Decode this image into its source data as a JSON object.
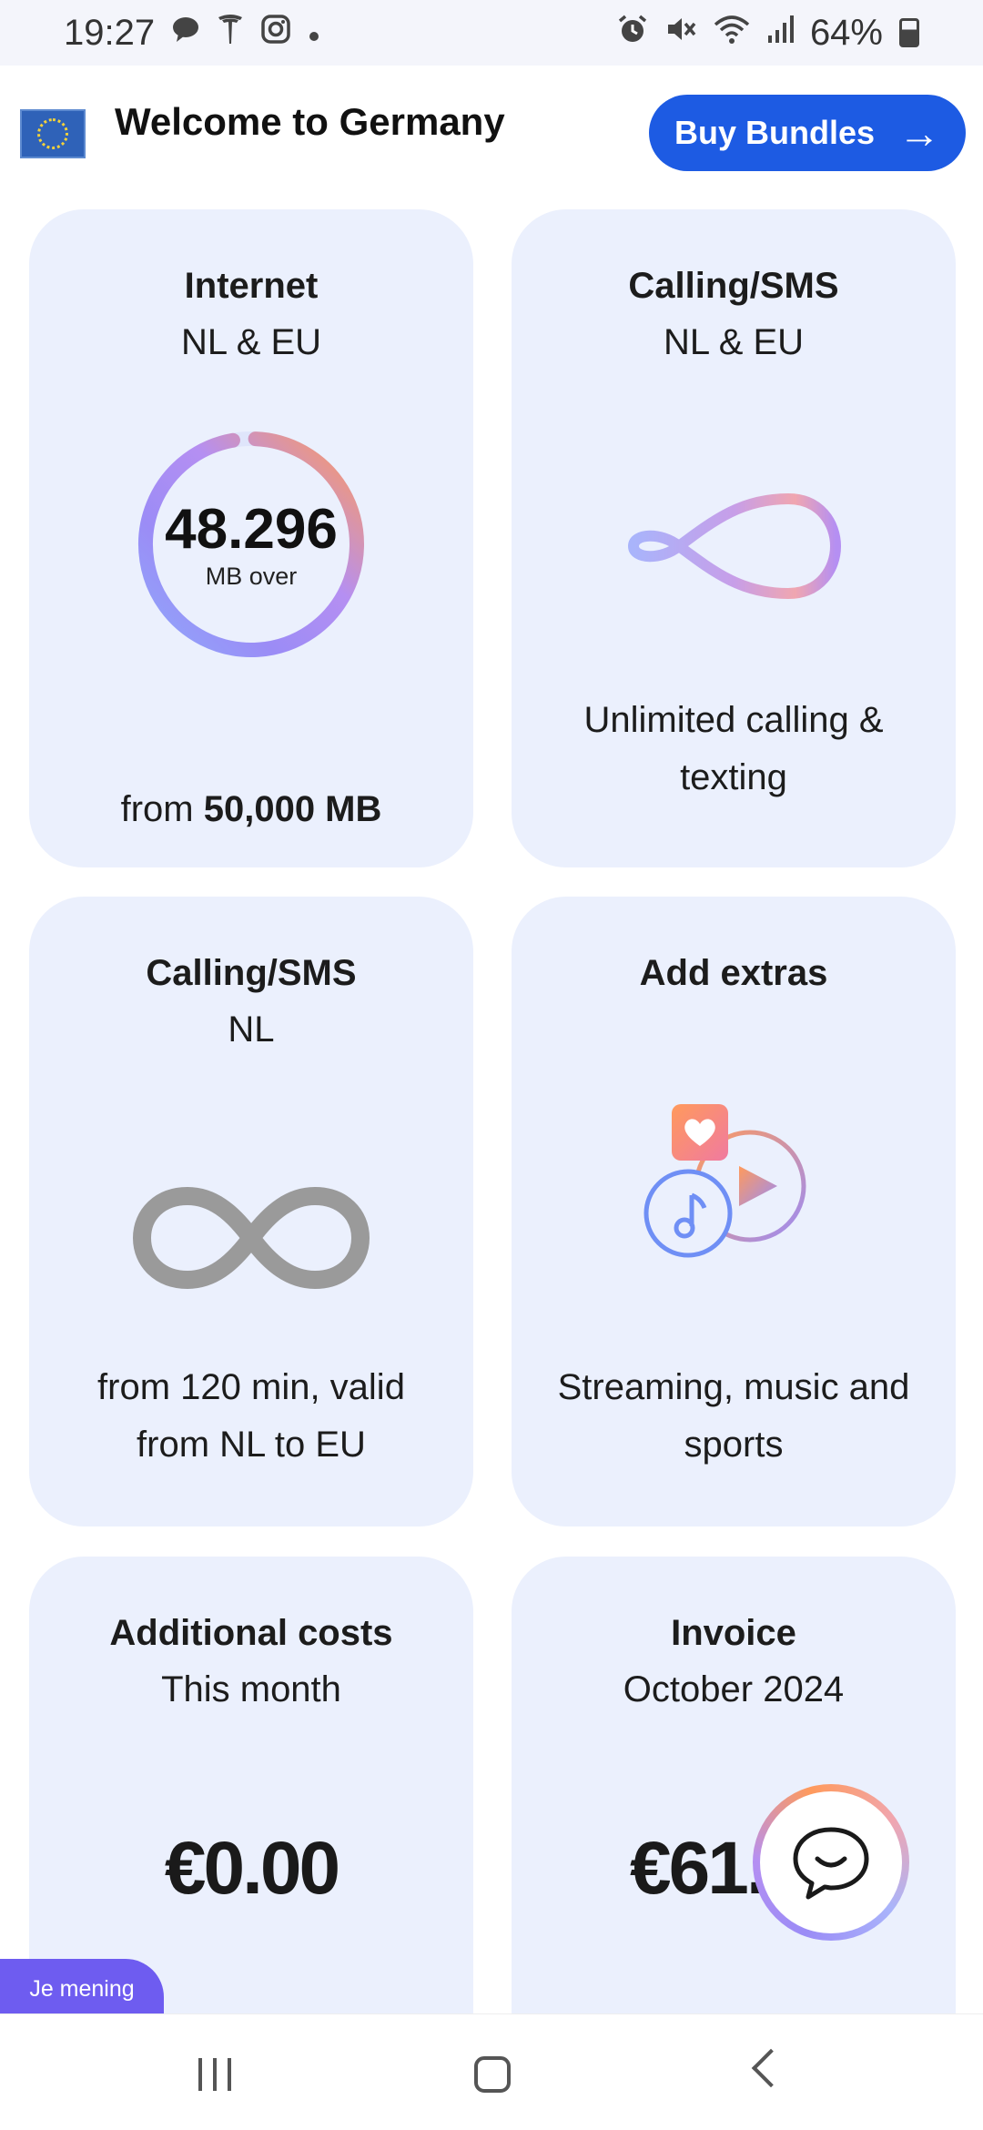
{
  "status_bar": {
    "time": "19:27",
    "battery": "64%",
    "left_icons": [
      "chat-bubble-icon",
      "tesla-icon",
      "instagram-icon",
      "dot-icon"
    ],
    "right_icons": [
      "alarm-icon",
      "mute-icon",
      "wifi-icon",
      "signal-icon",
      "battery-icon"
    ]
  },
  "header": {
    "title": "Welcome to Germany",
    "flag": "eu-flag-icon",
    "buy_label": "Buy Bundles",
    "buy_arrow": "→"
  },
  "cards": {
    "internet": {
      "title": "Internet",
      "subtitle": "NL & EU",
      "remaining_value": "48.296",
      "remaining_unit": "MB over",
      "remaining_fraction": 0.966,
      "foot_prefix": "from ",
      "foot_amount": "50,000",
      "foot_unit": " MB"
    },
    "calling_eu": {
      "title": "Calling/SMS",
      "subtitle": "NL & EU",
      "icon": "infinity-gradient-icon",
      "foot": "Unlimited calling & texting"
    },
    "calling_nl": {
      "title": "Calling/SMS",
      "subtitle": "NL",
      "icon": "infinity-gray-icon",
      "foot": "from 120 min, valid from NL to EU"
    },
    "extras": {
      "title": "Add extras",
      "icon": "media-extras-icon",
      "foot": "Streaming, music and sports"
    },
    "additional_costs": {
      "title": "Additional costs",
      "subtitle": "This month",
      "amount": "€0.00"
    },
    "invoice": {
      "title": "Invoice",
      "subtitle": "October 2024",
      "amount": "€61."
    }
  },
  "feedback": {
    "label": "Je mening"
  },
  "colors": {
    "accent": "#1d5be3",
    "card_bg": "#ebf0fd",
    "feedback_bg": "#6e5cf0",
    "gradient_orange": "#ff9a5c",
    "gradient_purple": "#9b8cf6",
    "gradient_blue": "#a9b4fb"
  }
}
